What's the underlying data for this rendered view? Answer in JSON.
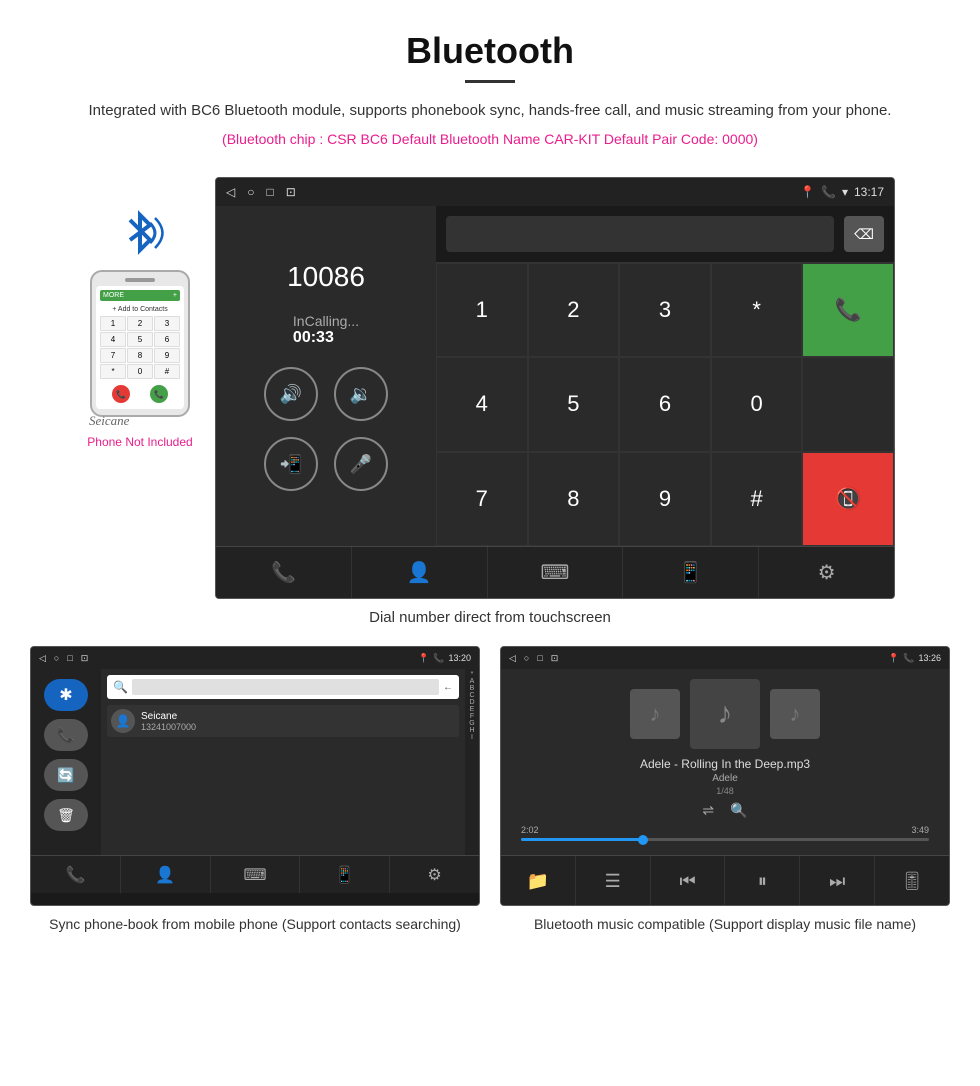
{
  "page": {
    "title": "Bluetooth",
    "description": "Integrated with BC6 Bluetooth module, supports phonebook sync, hands-free call, and music streaming from your phone.",
    "specs": "(Bluetooth chip : CSR BC6    Default Bluetooth Name CAR-KIT    Default Pair Code: 0000)"
  },
  "call_screen": {
    "number": "10086",
    "status": "InCalling...",
    "time": "00:33",
    "dialpad_keys": [
      "1",
      "2",
      "3",
      "*",
      "4",
      "5",
      "6",
      "0",
      "7",
      "8",
      "9",
      "#"
    ],
    "status_time": "13:17",
    "nav_icons": [
      "📞",
      "👤",
      "⌨",
      "📱",
      "⚙"
    ]
  },
  "caption_main": "Dial number direct from touchscreen",
  "phonebook_screen": {
    "status_time": "13:20",
    "contact_name": "Seicane",
    "contact_phone": "13241007000",
    "alpha": [
      "*",
      "A",
      "B",
      "C",
      "D",
      "E",
      "F",
      "G",
      "H",
      "I"
    ],
    "caption": "Sync phone-book from mobile phone\n(Support contacts searching)"
  },
  "music_screen": {
    "status_time": "13:26",
    "track_name": "Adele - Rolling In the Deep.mp3",
    "artist": "Adele",
    "count": "1/48",
    "time_current": "2:02",
    "time_total": "3:49",
    "caption": "Bluetooth music compatible\n(Support display music file name)"
  },
  "phone_not_included": "Phone Not Included"
}
